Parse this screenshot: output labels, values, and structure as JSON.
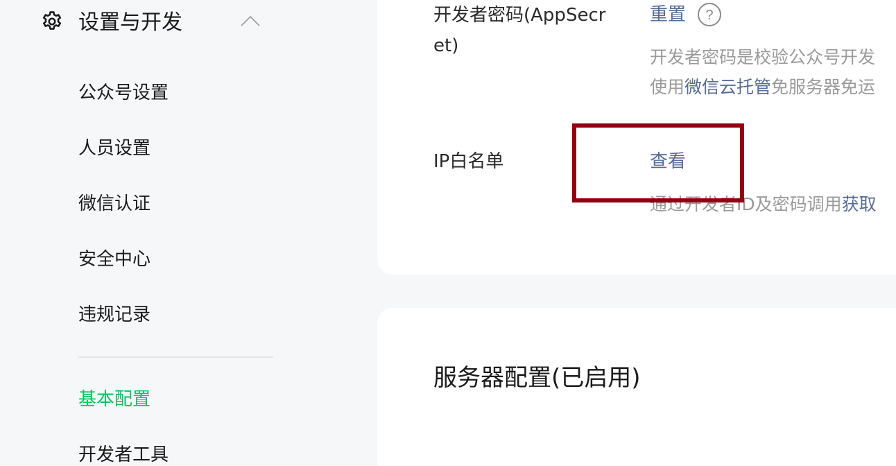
{
  "sidebar": {
    "section_title": "设置与开发",
    "items": [
      {
        "label": "公众号设置"
      },
      {
        "label": "人员设置"
      },
      {
        "label": "微信认证"
      },
      {
        "label": "安全中心"
      },
      {
        "label": "违规记录"
      },
      {
        "label": "基本配置",
        "active": true
      },
      {
        "label": "开发者工具"
      }
    ]
  },
  "main": {
    "appsecret": {
      "label": "开发者密码(AppSecret)",
      "action": "重置",
      "desc_line1": "开发者密码是校验公众号开发",
      "desc_line2_prefix": "使用",
      "desc_line2_link": "微信云托管",
      "desc_line2_suffix": "免服务器免运"
    },
    "ip_whitelist": {
      "label": "IP白名单",
      "action": "查看",
      "desc_prefix": "通过开发者ID及密码调用",
      "desc_link": "获取"
    },
    "server_config": {
      "title": "服务器配置(已启用)"
    }
  },
  "colors": {
    "accent_green": "#07c160",
    "link_blue": "#576b95",
    "highlight_red": "#930010",
    "muted_text": "#9a9a9a"
  },
  "icons": {
    "section": "gear-icon",
    "collapse": "chevron-up-icon",
    "help": "question-circle-icon"
  }
}
